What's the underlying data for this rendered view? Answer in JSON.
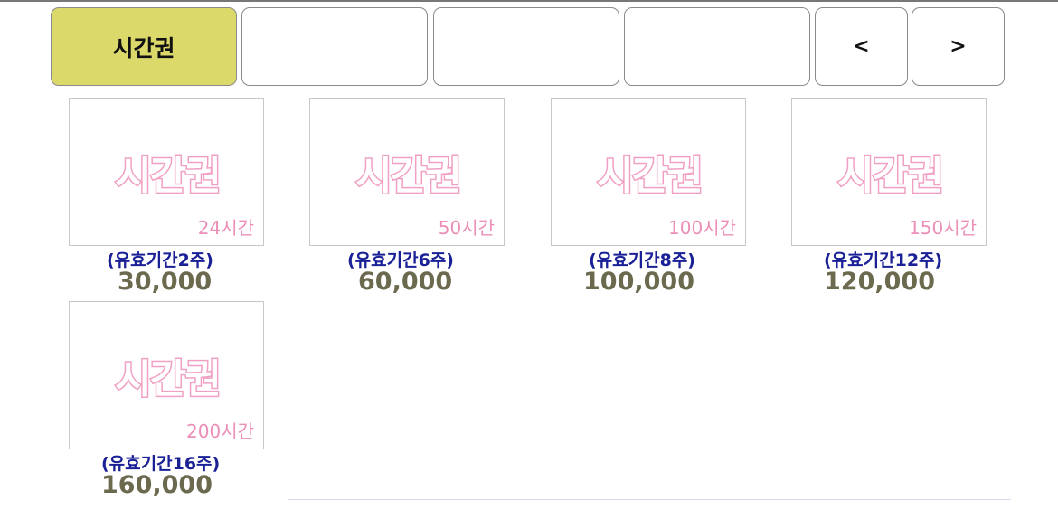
{
  "tabs": {
    "items": [
      {
        "label": "시간권",
        "active": true
      },
      {
        "label": ""
      },
      {
        "label": ""
      },
      {
        "label": ""
      }
    ],
    "prev_label": "<",
    "next_label": ">"
  },
  "products": [
    {
      "thumb_title": "시간권",
      "hours": "24시간",
      "validity": "(유효기간2주)",
      "price": "30,000"
    },
    {
      "thumb_title": "시간권",
      "hours": "50시간",
      "validity": "(유효기간6주)",
      "price": "60,000"
    },
    {
      "thumb_title": "시간권",
      "hours": "100시간",
      "validity": "(유효기간8주)",
      "price": "100,000"
    },
    {
      "thumb_title": "시간권",
      "hours": "150시간",
      "validity": "(유효기간12주)",
      "price": "120,000"
    },
    {
      "thumb_title": "시간권",
      "hours": "200시간",
      "validity": "(유효기간16주)",
      "price": "160,000"
    }
  ],
  "colors": {
    "active_tab": "#dcd96b",
    "thumb_text": "#f0a0c4",
    "validity_text": "#1a2196",
    "price_text": "#6b6a4f"
  }
}
